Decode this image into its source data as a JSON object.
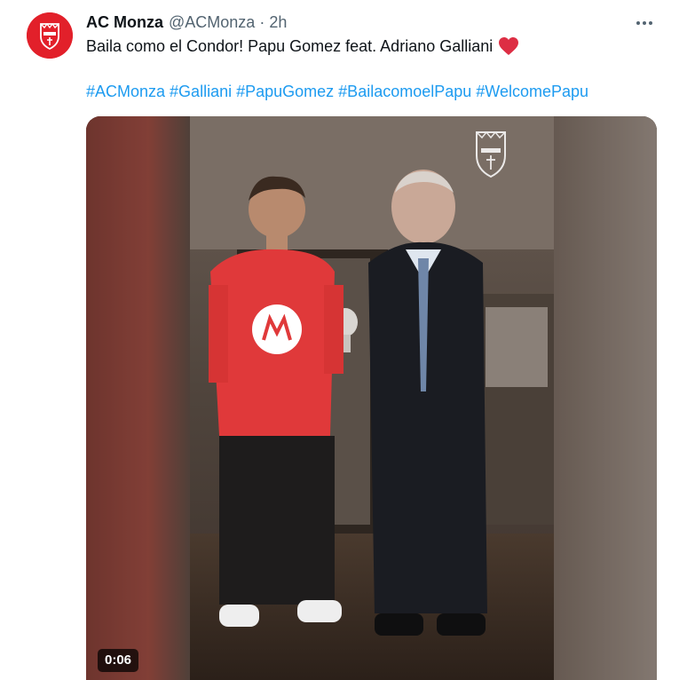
{
  "tweet": {
    "display_name": "AC Monza",
    "handle": "@ACMonza",
    "separator": "·",
    "time": "2h",
    "text": "Baila como el Condor! Papu Gomez feat. Adriano Galliani",
    "emoji": "heart",
    "hashtags": [
      "#ACMonza",
      "#Galliani",
      "#PapuGomez",
      "#BailacomoelPapu",
      "#WelcomePapu"
    ]
  },
  "avatar": {
    "logo": "monza-crest",
    "color": "#e2202a"
  },
  "video": {
    "duration": "0:06",
    "watermark": "monza-crest"
  },
  "icons": {
    "more": "more-horizontal-icon",
    "heart": "red-heart-emoji"
  },
  "colors": {
    "link": "#1d9bf0",
    "secondary_text": "#536471",
    "primary_text": "#0f1419",
    "heart": "#e0245e"
  }
}
